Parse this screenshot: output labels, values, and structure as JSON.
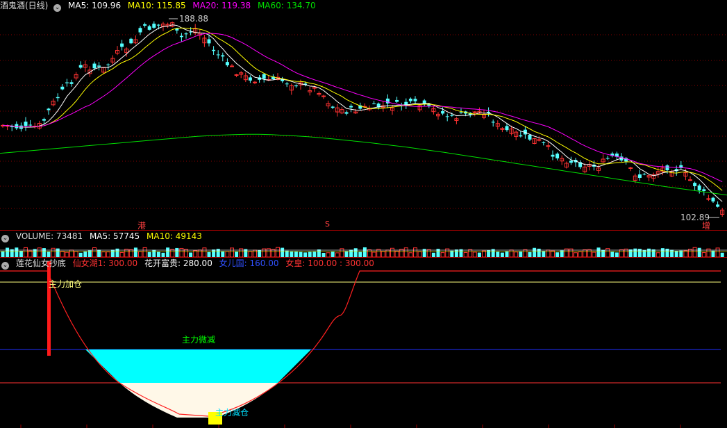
{
  "price_header": {
    "name": "酒鬼酒(日线)",
    "ma5": "MA5: 109.96",
    "ma10": "MA10: 115.85",
    "ma20": "MA20: 119.38",
    "ma60": "MA60: 134.70"
  },
  "price_annotations": {
    "high": "188.88",
    "low": "102.89",
    "marker_gang": "港",
    "marker_s": "S",
    "marker_zeng": "增"
  },
  "volume_header": {
    "volume": "VOLUME: 73481",
    "ma5": "MA5: 57745",
    "ma10": "MA10: 49143"
  },
  "indicator_header": {
    "name": "莲花仙女抄底",
    "xian_nv_hu": "仙女湖1: 300.00",
    "hua_kai": "花开富贵: 280.00",
    "nv_er_guo": "女儿国: 160.00",
    "nv_huang": "女皇: 100.00 : 300.00"
  },
  "indicator_labels": {
    "add": "主力加仓",
    "reduce_small": "主力微减",
    "reduce": "主力减仓"
  },
  "colors": {
    "up": "#ff3232",
    "down": "#54ffff",
    "ma5": "#ffffff",
    "ma10": "#ffff00",
    "ma20": "#ff00ff",
    "ma60": "#00e000",
    "grid": "#8b0000",
    "cyan_fill": "#00ffff",
    "cream_fill": "#fff8e8"
  },
  "icons": {
    "collapse": "chevron-circle-icon"
  },
  "chart_data": {
    "type": "candlestick",
    "ylim": [
      100,
      195
    ],
    "ma60": [
      126,
      126.5,
      127,
      127.5,
      128,
      128.5,
      129,
      129.5,
      130,
      130.5,
      131,
      131.5,
      132,
      132.5,
      133,
      133.5,
      134,
      134.3,
      134.6,
      134.8,
      135,
      135,
      134.8,
      134.5,
      134.2,
      133.8,
      133.3,
      132.8,
      132.2,
      131.6,
      131,
      130.3,
      129.6,
      128.9,
      128.1,
      127.3,
      126.5,
      125.6,
      124.7,
      123.8,
      122.9,
      122,
      121.1,
      120.2,
      119.3,
      118.4,
      117.5,
      116.6,
      115.7,
      114.8,
      113.9,
      113,
      112.1,
      111.2,
      110.3,
      109.5,
      108.7,
      107.9,
      107.1,
      106.3
    ]
  }
}
